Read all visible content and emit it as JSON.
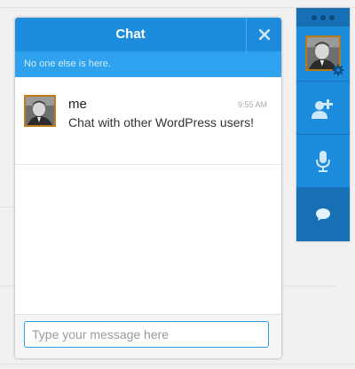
{
  "chat": {
    "title": "Chat",
    "close_icon": "close-icon",
    "status": "No one else is here.",
    "messages": [
      {
        "author": "me",
        "time": "9:55 AM",
        "text": "Chat with other WordPress users!",
        "avatar_icon": "user-avatar"
      }
    ],
    "input": {
      "placeholder": "Type your message here",
      "value": ""
    }
  },
  "sidebar": {
    "menu_icon": "ellipsis-icon",
    "avatar_icon": "user-avatar",
    "settings_icon": "gear-icon",
    "buttons": [
      {
        "name": "add-user-button",
        "icon": "add-user-icon"
      },
      {
        "name": "microphone-button",
        "icon": "microphone-icon"
      },
      {
        "name": "chat-button",
        "icon": "chat-bubble-icon",
        "active": true
      }
    ]
  },
  "colors": {
    "accent": "#1e8cdc",
    "accent_light": "#2ea1ef",
    "accent_dark": "#1670b3",
    "avatar_border": "#c07a18"
  }
}
